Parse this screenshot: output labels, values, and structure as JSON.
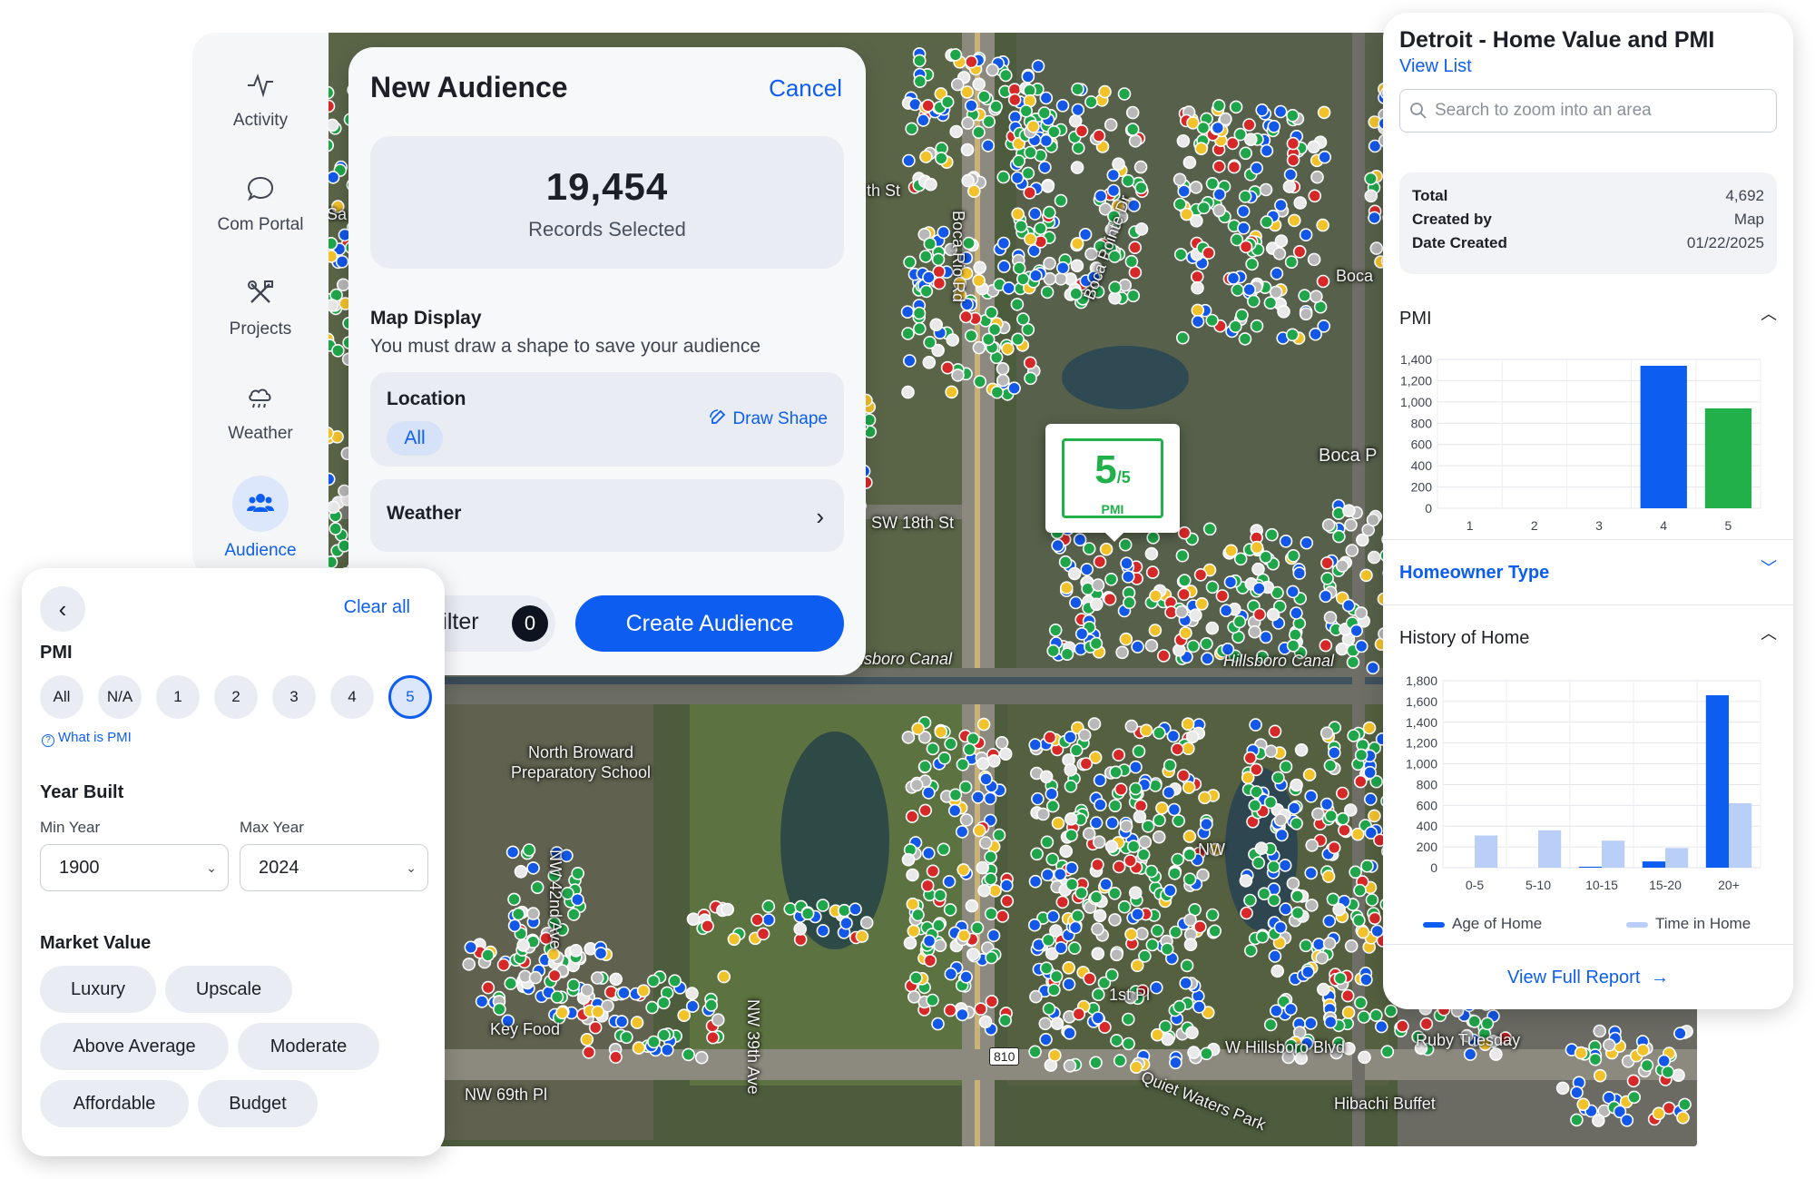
{
  "nav": {
    "items": [
      {
        "label": "Activity",
        "icon": "activity-icon"
      },
      {
        "label": "Com Portal",
        "icon": "chat-icon"
      },
      {
        "label": "Projects",
        "icon": "tools-icon"
      },
      {
        "label": "Weather",
        "icon": "weather-icon"
      },
      {
        "label": "Audience",
        "icon": "audience-icon",
        "active": true
      }
    ]
  },
  "audience": {
    "title": "New Audience",
    "cancel": "Cancel",
    "records_count": "19,454",
    "records_label": "Records Selected",
    "map_display_title": "Map Display",
    "map_display_hint": "You must draw a shape to save your audience",
    "location_label": "Location",
    "location_chip": "All",
    "draw_shape": "Draw Shape",
    "weather_label": "Weather",
    "filter_label": "Filter",
    "filter_count": "0",
    "create_button": "Create Audience"
  },
  "filters": {
    "clear_all": "Clear all",
    "pmi_title": "PMI",
    "pmi_options": [
      "All",
      "N/A",
      "1",
      "2",
      "3",
      "4",
      "5"
    ],
    "pmi_selected": "5",
    "what_is_pmi": "What is PMI",
    "year_built_title": "Year Built",
    "min_year_label": "Min Year",
    "min_year_value": "1900",
    "max_year_label": "Max Year",
    "max_year_value": "2024",
    "market_value_title": "Market Value",
    "market_values": [
      "Luxury",
      "Upscale",
      "Above Average",
      "Moderate",
      "Affordable",
      "Budget"
    ]
  },
  "map": {
    "labels": [
      "Boca Rio Rd",
      "Boca Pointe Dr",
      "Boca",
      "Boca P",
      "SW 18th St",
      "th St",
      "Sa",
      "illsboro Canal",
      "Hillsboro Canal",
      "North Broward Preparatory School",
      "NW 42nd Ave",
      "NW 39th Ave",
      "NW 69th Pl",
      "Key Food",
      "810",
      "Quiet Waters Park",
      "W Hillsboro Blvd",
      "Ruby Tuesday",
      "Hibachi Buffet",
      "1st Pl",
      "NW"
    ],
    "marker": {
      "score": "5",
      "out_of": "/5",
      "label": "PMI"
    }
  },
  "report": {
    "title": "Detroit - Home Value and PMI",
    "view_list": "View List",
    "search_placeholder": "Search to zoom into an area",
    "info": [
      {
        "key": "Total",
        "value": "4,692"
      },
      {
        "key": "Created by",
        "value": "Map"
      },
      {
        "key": "Date Created",
        "value": "01/22/2025"
      }
    ],
    "pmi_section": "PMI",
    "homeowner_section": "Homeowner Type",
    "history_section": "History of Home",
    "view_full_report": "View Full Report"
  },
  "colors": {
    "accent": "#0d5ef0",
    "green": "#22b04b",
    "light_blue": "#b9cff7"
  },
  "chart_data": [
    {
      "type": "bar",
      "title": "PMI",
      "categories": [
        "1",
        "2",
        "3",
        "4",
        "5"
      ],
      "values": [
        0,
        0,
        0,
        1340,
        940
      ],
      "bar_colors": [
        "#0d5ef0",
        "#0d5ef0",
        "#0d5ef0",
        "#0d5ef0",
        "#22b04b"
      ],
      "yticks": [
        "0",
        "200",
        "400",
        "600",
        "800",
        "1,000",
        "1,200",
        "1,400"
      ],
      "ylim": [
        0,
        1400
      ]
    },
    {
      "type": "bar",
      "title": "History of Home",
      "categories": [
        "0-5",
        "5-10",
        "10-15",
        "15-20",
        "20+"
      ],
      "series": [
        {
          "name": "Age of Home",
          "color": "#0d5ef0",
          "values": [
            0,
            0,
            10,
            60,
            1660
          ]
        },
        {
          "name": "Time in Home",
          "color": "#b9cff7",
          "values": [
            310,
            360,
            260,
            190,
            620
          ]
        }
      ],
      "yticks": [
        "0",
        "200",
        "400",
        "600",
        "800",
        "1,000",
        "1,200",
        "1,400",
        "1,600",
        "1,800"
      ],
      "ylim": [
        0,
        1800
      ]
    }
  ]
}
